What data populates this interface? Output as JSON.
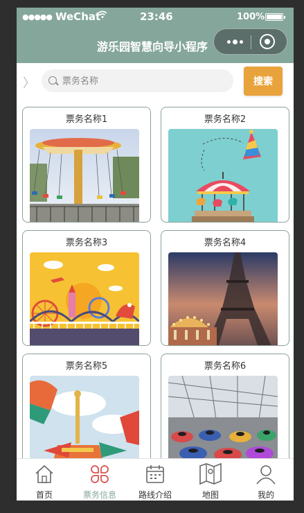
{
  "status_bar": {
    "signal": "●●●●●",
    "carrier": "WeChat",
    "time": "23:46",
    "battery": "100%",
    "battery_level": 1.0
  },
  "nav": {
    "title": "游乐园智慧向导小程序"
  },
  "search": {
    "placeholder": "票务名称",
    "button_label": "搜索"
  },
  "tickets": [
    {
      "name": "票务名称1"
    },
    {
      "name": "票务名称2"
    },
    {
      "name": "票务名称3"
    },
    {
      "name": "票务名称4"
    },
    {
      "name": "票务名称5"
    },
    {
      "name": "票务名称6"
    }
  ],
  "tabs": [
    {
      "label": "首页",
      "icon": "home-icon"
    },
    {
      "label": "票务信息",
      "icon": "ticket-icon",
      "active": true
    },
    {
      "label": "路线介绍",
      "icon": "calendar-icon"
    },
    {
      "label": "地图",
      "icon": "map-icon"
    },
    {
      "label": "我的",
      "icon": "user-icon"
    }
  ],
  "colors": {
    "nav_bg": "#85a69b",
    "accent": "#e8a33c",
    "active_tab": "#85a69b",
    "active_icon": "#d9534f"
  }
}
